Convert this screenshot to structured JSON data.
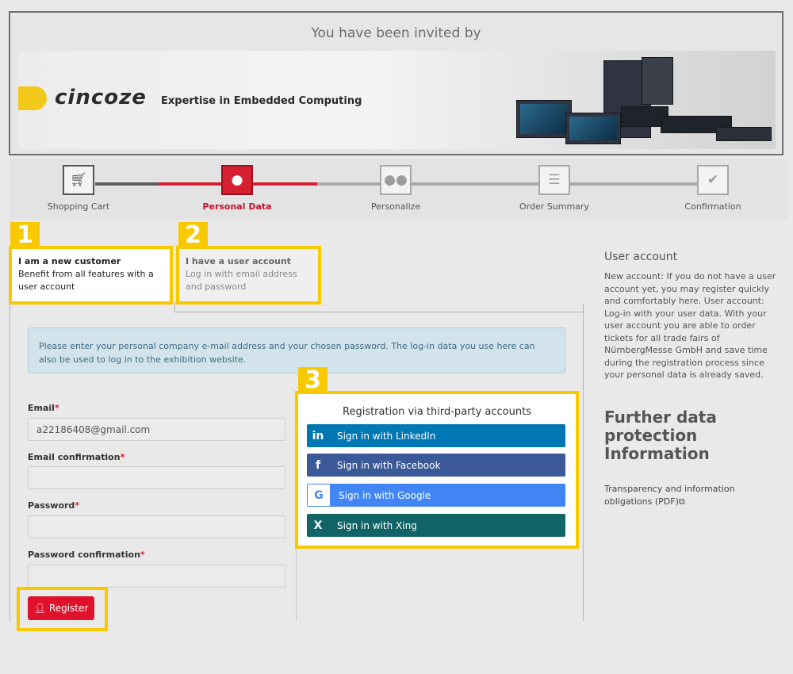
{
  "invite": {
    "title": "You have been invited by"
  },
  "banner": {
    "brand": "cincoze",
    "tagline": "Expertise in Embedded Computing"
  },
  "steps": [
    {
      "label": "Shopping Cart",
      "icon": "cart-icon",
      "state": "done"
    },
    {
      "label": "Personal Data",
      "icon": "user-icon",
      "state": "active"
    },
    {
      "label": "Personalize",
      "icon": "group-icon",
      "state": "todo"
    },
    {
      "label": "Order Summary",
      "icon": "list-icon",
      "state": "todo"
    },
    {
      "label": "Confirmation",
      "icon": "check-icon",
      "state": "todo"
    }
  ],
  "callouts": [
    "1",
    "2",
    "3"
  ],
  "tabs": {
    "new_customer": {
      "title": "I am a new customer",
      "desc": "Benefit from all features with a user account"
    },
    "user_account": {
      "title": "I have a user account",
      "desc": "Log in with email address and password"
    }
  },
  "info": "Please enter your personal company e-mail address and your chosen password. The log-in data you use here can also be used to log in to the exhibition website.",
  "form": {
    "email_label": "Email",
    "email_value": "a22186408@gmail.com",
    "email_confirm_label": "Email confirmation",
    "password_label": "Password",
    "password_confirm_label": "Password confirmation",
    "required_mark": "*",
    "register_label": "Register"
  },
  "social": {
    "title": "Registration via third-party accounts",
    "buttons": [
      {
        "label": "Sign in with LinkedIn",
        "icon": "linkedin-icon",
        "glyph": "in",
        "color": "#0077b5"
      },
      {
        "label": "Sign in with Facebook",
        "icon": "facebook-icon",
        "glyph": "f",
        "color": "#3b5998"
      },
      {
        "label": "Sign in with Google",
        "icon": "google-icon",
        "glyph": "G",
        "color": "#4285f4"
      },
      {
        "label": "Sign in with Xing",
        "icon": "xing-icon",
        "glyph": "X",
        "color": "#126567"
      }
    ]
  },
  "sidebar": {
    "heading": "User account",
    "text": "New account: If you do not have a user account yet, you may register quickly and comfortably here. User account: Log-in with your user data. With your user account you are able to order tickets for all trade fairs of NürnbergMesse GmbH and save time during the registration process since your personal data is already saved.",
    "big_heading": "Further data protection Information",
    "link": "Transparency and information obligations (PDF)"
  }
}
